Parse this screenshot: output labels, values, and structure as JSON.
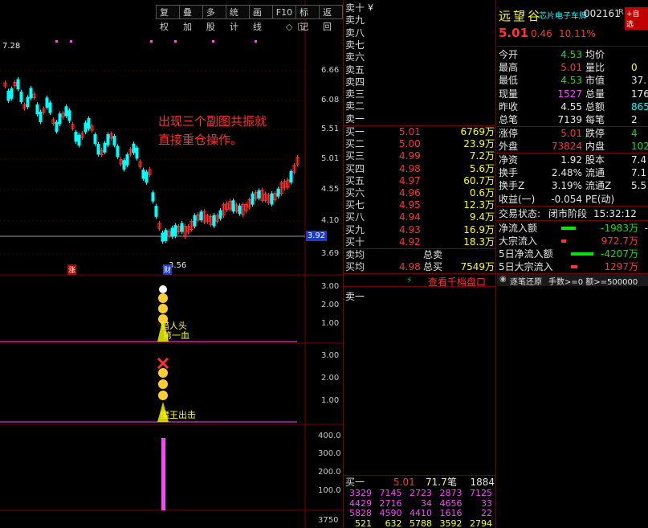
{
  "toolbar": {
    "buttons": [
      "复权",
      "叠加",
      "多股",
      "统计",
      "画线",
      "F10",
      "标记",
      "返回"
    ]
  },
  "main_chart": {
    "price_axis": [
      "6.66",
      "6.08",
      "5.51",
      "5.01",
      "4.55",
      "4.10",
      "3.69"
    ],
    "current_price_tag": "3.92",
    "high_label": "7.28",
    "low_label": "3.56",
    "annotation_line1": "出现三个副图共振就",
    "annotation_line2": "直接重仓操作。",
    "badge_red": "涨",
    "badge_blue": "财",
    "diamond_icon": "◇",
    "close_icon": "□"
  },
  "sub1": {
    "axis": [
      "3.00",
      "2.00",
      "1.00"
    ],
    "label1": "猎人头",
    "label2": "第一血"
  },
  "sub2": {
    "axis": [
      "3.00",
      "2.00",
      "1.00"
    ],
    "label": "魔王出击"
  },
  "sub3": {
    "axis": [
      "400.0",
      "300.0",
      "200.0",
      "100.0"
    ],
    "bottom_tick": "3750"
  },
  "orderbook": {
    "sell_labels": [
      "卖十",
      "卖九",
      "卖八",
      "卖七",
      "卖六",
      "卖五",
      "卖四",
      "卖三",
      "卖二",
      "卖一"
    ],
    "sell_mark": "¥",
    "buys": [
      {
        "label": "买一",
        "price": "5.01",
        "vol": "6769万"
      },
      {
        "label": "买二",
        "price": "5.00",
        "vol": "23.9万"
      },
      {
        "label": "买三",
        "price": "4.99",
        "vol": "7.2万"
      },
      {
        "label": "买四",
        "price": "4.98",
        "vol": "5.6万"
      },
      {
        "label": "买五",
        "price": "4.97",
        "vol": "60.7万"
      },
      {
        "label": "买六",
        "price": "4.96",
        "vol": "0.6万"
      },
      {
        "label": "买七",
        "price": "4.95",
        "vol": "12.3万"
      },
      {
        "label": "买八",
        "price": "4.94",
        "vol": "9.4万"
      },
      {
        "label": "买九",
        "price": "4.93",
        "vol": "16.9万"
      },
      {
        "label": "买十",
        "price": "4.92",
        "vol": "18.3万"
      }
    ],
    "sell_avg_label": "卖均",
    "buy_avg_label": "买均",
    "total_sell_label": "总卖",
    "total_buy_label": "总买",
    "buy_avg_price": "4.98",
    "total_buy_vol": "7549万",
    "view_depth_label": "查看千档盘口",
    "queue_label": "卖一",
    "queue_buy_label": "买一",
    "queue_buy_price": "5.01",
    "queue_buy_per": "71.7",
    "queue_buy_unit": "笔",
    "queue_buy_count": "1884",
    "queue_rows": [
      [
        "3329",
        "7145",
        "2723",
        "2873",
        "7125"
      ],
      [
        "4429",
        "2716",
        "34",
        "4656",
        "33"
      ],
      [
        "5828",
        "4590",
        "4410",
        "1616",
        "22"
      ],
      [
        "521",
        "632",
        "5788",
        "3592",
        "2794"
      ]
    ]
  },
  "quote": {
    "name": "远望谷",
    "concept": "芯片电子车牌",
    "code": "002161",
    "r_badge": "R",
    "add_button": "+自选",
    "price": "5.01",
    "change": "0.46",
    "pct": "10.11%",
    "rows": [
      {
        "l1": "今开",
        "v1": "4.53",
        "l2": "均价",
        "v2": ""
      },
      {
        "l1": "最高",
        "v1": "5.01",
        "l2": "量比",
        "v2": "0"
      },
      {
        "l1": "最低",
        "v1": "4.53",
        "l2": "市值",
        "v2": "37."
      },
      {
        "l1": "现量",
        "v1": "1527",
        "l2": "总量",
        "v2": "176"
      },
      {
        "l1": "昨收",
        "v1": "4.55",
        "l2": "总额",
        "v2": "865"
      },
      {
        "l1": "总笔",
        "v1": "7139",
        "l2": "每笔",
        "v2": "2"
      }
    ],
    "limit_rows": [
      {
        "l1": "涨停",
        "v1": "5.01",
        "l2": "跌停",
        "v2": "4"
      },
      {
        "l1": "外盘",
        "v1": "73824",
        "l2": "内盘",
        "v2": "102"
      }
    ],
    "fund_rows": [
      {
        "l1": "净资",
        "v1": "1.92",
        "l2": "股本",
        "v2": "7.4"
      },
      {
        "l1": "换手",
        "v1": "2.48%",
        "l2": "流通",
        "v2": "7.1"
      },
      {
        "l1": "换手Z",
        "v1": "3.19%",
        "l2": "流通Z",
        "v2": "5.5"
      },
      {
        "l1": "收益(一)",
        "v1": "-0.054",
        "l2": "PE(动)",
        "v2": ""
      }
    ],
    "trade_status_label": "交易状态:",
    "trade_status": "闭市阶段",
    "trade_time": "15:32:12",
    "flow_rows": [
      {
        "label": "净流入额",
        "value": "-1983万",
        "extra": "-"
      },
      {
        "label": "大宗流入",
        "value": "972.7万",
        "extra": ""
      },
      {
        "label": "5日净流入额",
        "value": "-4207万",
        "extra": ""
      },
      {
        "label": "5日大宗流入",
        "value": "1297万",
        "extra": ""
      }
    ],
    "tick_title": "逐笔还原",
    "tick_filter": "手数>=0 额>=500000"
  },
  "colors": {
    "up": "#ff3232",
    "down": "#00ffff",
    "accent": "#ffff00",
    "grid": "#7a0000"
  }
}
